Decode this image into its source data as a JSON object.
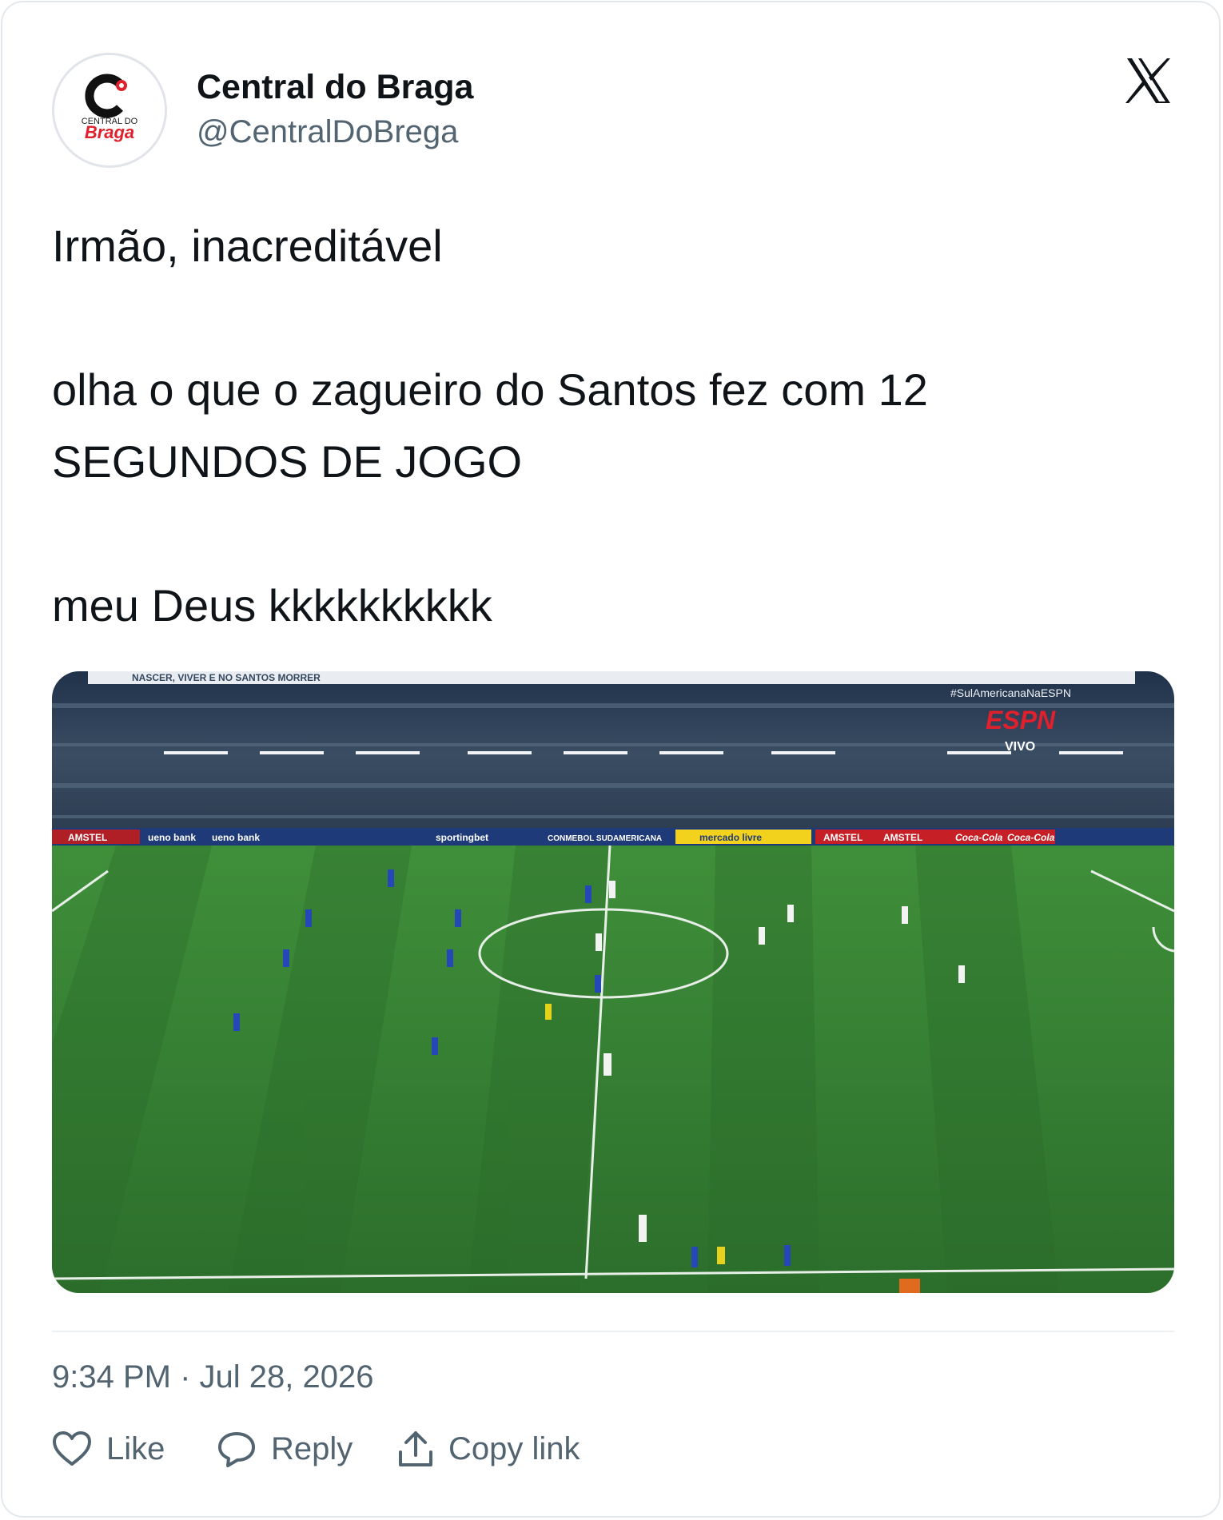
{
  "tweet": {
    "author_name": "Central do Braga",
    "author_handle": "@CentralDoBrega",
    "avatar_text_top": "CENTRAL DO",
    "avatar_text_bottom": "Braga",
    "text": "Irmão, inacreditável\n\nolha o que o zagueiro do Santos fez com 12\nSEGUNDOS DE JOGO\n\nmeu Deus kkkkkkkkkk",
    "timestamp": "9:34 PM · Jul 28, 2026",
    "brand_icon": "x-logo-icon"
  },
  "media": {
    "hashtag_overlay": "#SulAmericanaNaESPN",
    "broadcaster": "ESPN",
    "live_label": "VIVO",
    "banner_top": "NASCER, VIVER E NO SANTOS MORRER",
    "ad_boards": [
      "AMSTEL",
      "ueno bank",
      "ueno bank",
      "sportingbet",
      "CONMEBOL SUDAMERICANA",
      "mercado livre",
      "AMSTEL",
      "AMSTEL",
      "Coca-Cola",
      "Coca-Cola"
    ]
  },
  "actions": {
    "like_label": "Like",
    "reply_label": "Reply",
    "copy_label": "Copy link"
  },
  "colors": {
    "text_primary": "#0f1419",
    "text_secondary": "#536471",
    "pitch_green": "#2f7d32",
    "brand_red": "#e0202c"
  }
}
